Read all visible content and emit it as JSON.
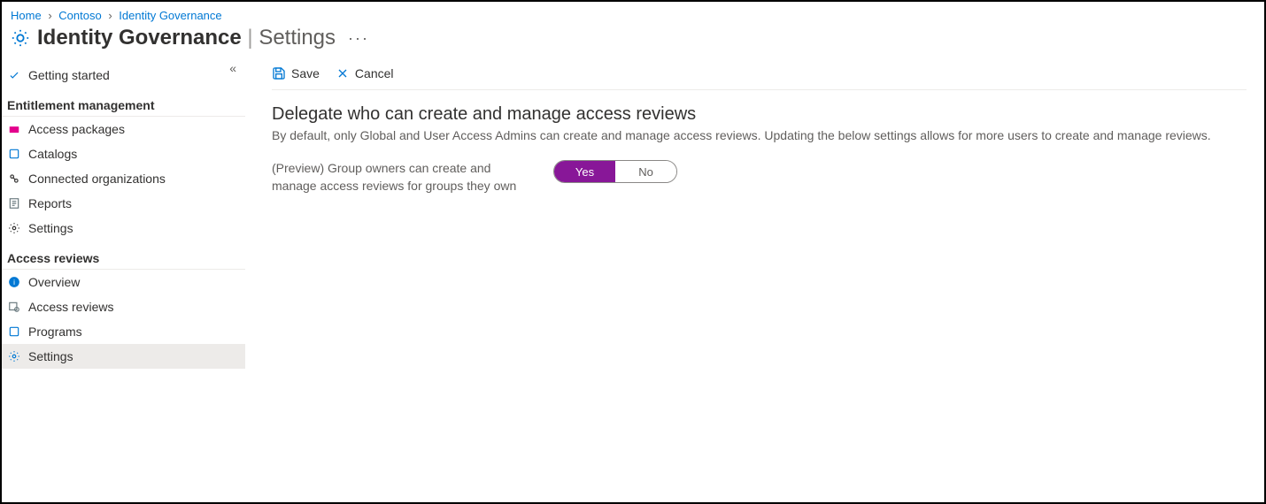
{
  "breadcrumb": {
    "items": [
      {
        "label": "Home"
      },
      {
        "label": "Contoso"
      },
      {
        "label": "Identity Governance"
      }
    ]
  },
  "header": {
    "title": "Identity Governance",
    "subtitle": "Settings"
  },
  "sidebar": {
    "getting_started": "Getting started",
    "section_entitlement": "Entitlement management",
    "entitlement_items": [
      {
        "label": "Access packages"
      },
      {
        "label": "Catalogs"
      },
      {
        "label": "Connected organizations"
      },
      {
        "label": "Reports"
      },
      {
        "label": "Settings"
      }
    ],
    "section_access_reviews": "Access reviews",
    "access_review_items": [
      {
        "label": "Overview"
      },
      {
        "label": "Access reviews"
      },
      {
        "label": "Programs"
      },
      {
        "label": "Settings"
      }
    ]
  },
  "toolbar": {
    "save_label": "Save",
    "cancel_label": "Cancel"
  },
  "content": {
    "heading": "Delegate who can create and manage access reviews",
    "description": "By default, only Global and User Access Admins can create and manage access reviews. Updating the below settings allows for more users to create and manage reviews.",
    "setting_label": "(Preview) Group owners can create and manage access reviews for groups they own",
    "toggle": {
      "yes": "Yes",
      "no": "No",
      "value": "Yes"
    }
  }
}
